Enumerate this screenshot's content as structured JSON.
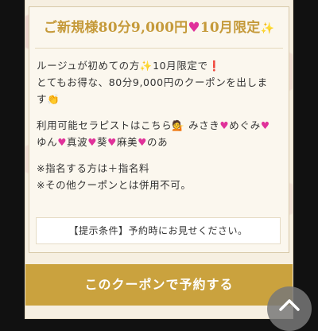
{
  "coupon": {
    "title_pre": "ご新規様80分9,000円",
    "title_post": "10月限定",
    "icons": {
      "title_heart": "heart-icon",
      "title_sparkle": "sparkles-icon"
    },
    "intro": {
      "line1_pre": "ルージュが初めての方",
      "line1_mid": "10月限定で",
      "line2": "とてもお得な、80分9,000円のクーポンを出しま",
      "line3": "す"
    },
    "therapists": {
      "label": "利用可能セラピストはこちら",
      "names": [
        "みさき",
        "めぐみ",
        "ゆん",
        "真波",
        "葵",
        "麻美",
        "のあ"
      ]
    },
    "notes": [
      "※指名する方は＋指名料",
      "※その他クーポンとは併用不可。"
    ],
    "condition": "【提示条件】予約時にお見せください。"
  },
  "cta": {
    "label": "このクーポンで予約する"
  },
  "colors": {
    "gold": "#caa23e",
    "title_gold": "#c59a3a",
    "heart": "#e0319a",
    "card_bg": "#f6efe1"
  }
}
